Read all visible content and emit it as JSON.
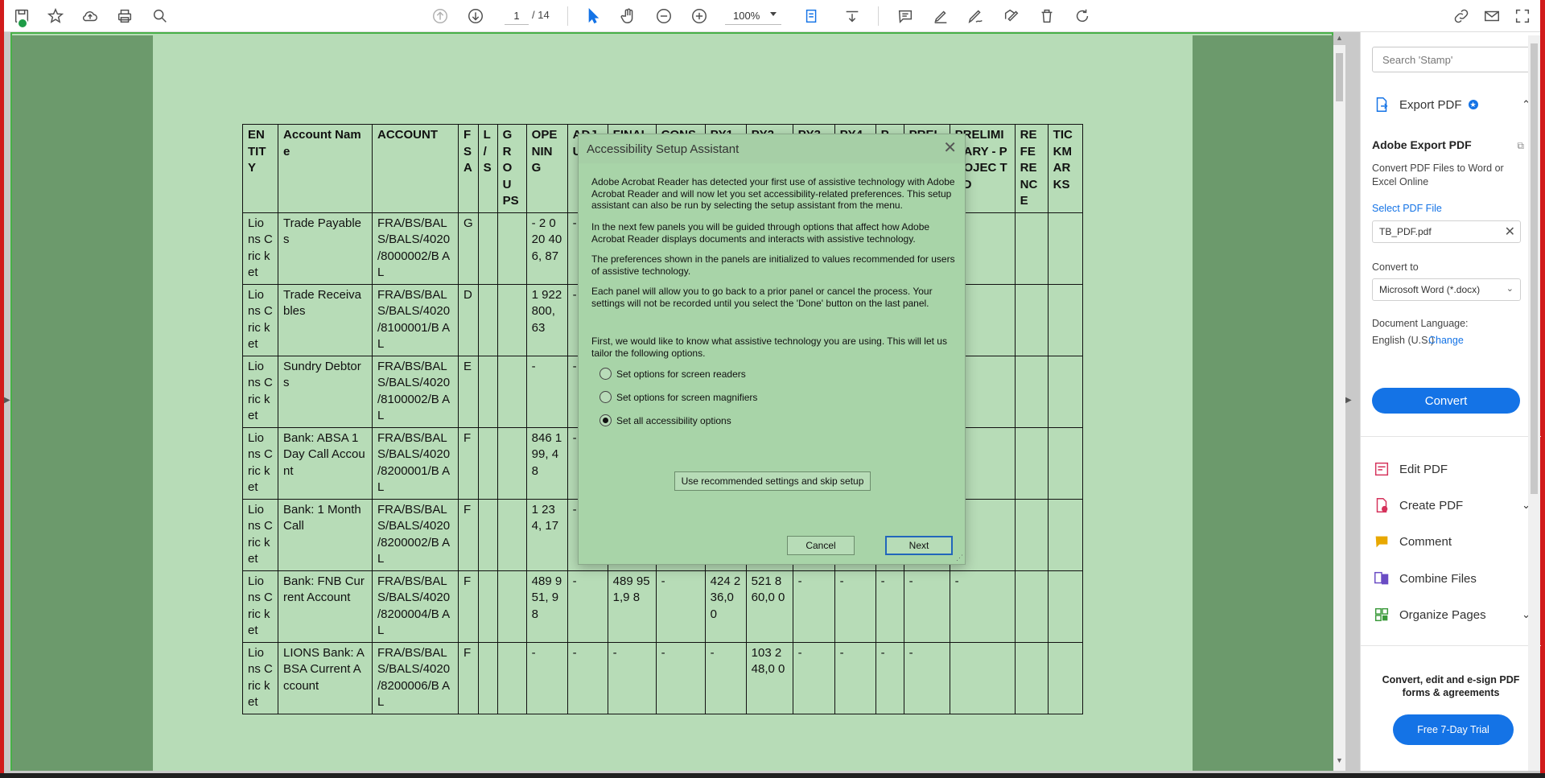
{
  "toolbar": {
    "page_current": "1",
    "page_total": "/ 14",
    "zoom": "100%"
  },
  "table": {
    "headers": [
      "EN TIT Y",
      "Account Name",
      "ACCOUNT",
      "F S A",
      "L / S",
      "G R O U PS",
      "OPE NIN G",
      "ADJ U N",
      "FINAL",
      "CONSO",
      "PY1",
      "PY2",
      "PY3",
      "PY4",
      "P",
      "PREL",
      "PRELIMI NARY - PROJEC TED",
      "RE FE RE NC E",
      "TIC KM AR KS"
    ],
    "rows": [
      [
        "Lio ns Cric ket",
        "Trade Payables",
        "FRA/BS/BAL S/BALS/4020 /8000002/B AL",
        "G",
        "",
        "",
        "- 2 020 406, 87",
        "-",
        "",
        "",
        "",
        "",
        "",
        "",
        "",
        "",
        "-",
        "",
        ""
      ],
      [
        "Lio ns Cric ket",
        "Trade Receivables",
        "FRA/BS/BAL S/BALS/4020 /8100001/B AL",
        "D",
        "",
        "",
        "1 922 800, 63",
        "-",
        "",
        "",
        "",
        "",
        "",
        "",
        "",
        "",
        "-",
        "",
        ""
      ],
      [
        "Lio ns Cric ket",
        "Sundry Debtors",
        "FRA/BS/BAL S/BALS/4020 /8100002/B AL",
        "E",
        "",
        "",
        "-",
        "-",
        "",
        "",
        "",
        "",
        "",
        "",
        "",
        "",
        "-",
        "",
        ""
      ],
      [
        "Lio ns Cric ket",
        "Bank: ABSA 1 Day Call Account",
        "FRA/BS/BAL S/BALS/4020 /8200001/B AL",
        "F",
        "",
        "",
        "846 199, 48",
        "-",
        "",
        "",
        "",
        "",
        "",
        "",
        "",
        "",
        "-",
        "",
        ""
      ],
      [
        "Lio ns Cric ket",
        "Bank: 1 Month Call",
        "FRA/BS/BAL S/BALS/4020 /8200002/B AL",
        "F",
        "",
        "",
        "1 234, 17",
        "-",
        "",
        "",
        "",
        "",
        "",
        "",
        "",
        "",
        "-",
        "",
        ""
      ],
      [
        "Lio ns Cric ket",
        "Bank: FNB Current Account",
        "FRA/BS/BAL S/BALS/4020 /8200004/B AL",
        "F",
        "",
        "",
        "489 951, 98",
        "-",
        "489 951,9 8",
        "-",
        "424 236,0 0",
        "521 860,0 0",
        "-",
        "-",
        "-",
        "-",
        "-",
        "",
        ""
      ],
      [
        "Lio ns Cric ket",
        "LIONS Bank: ABSA Current Account",
        "FRA/BS/BAL S/BALS/4020 /8200006/B AL",
        "F",
        "",
        "",
        "-",
        "-",
        "-",
        "-",
        "-",
        "103 248,0 0",
        "-",
        "-",
        "-",
        "-",
        "",
        "",
        ""
      ]
    ]
  },
  "dialog": {
    "title": "Accessibility Setup Assistant",
    "para1": "Adobe Acrobat Reader has detected your first use of assistive technology with Adobe Acrobat Reader and will now let you set accessibility-related preferences. This setup assistant can also be run by selecting the setup assistant from the  menu.",
    "para2": "In the next few panels you will be guided through options that affect how Adobe Acrobat Reader displays documents and interacts with assistive technology.",
    "para3": "The preferences shown in the panels are initialized to values recommended for users of assistive technology.",
    "para4": "Each panel will allow you to go back to a prior panel or cancel the process. Your settings will not be recorded until you select the 'Done' button on the last panel.",
    "para5": "First, we would like to know what assistive technology you are using. This will let us tailor the following options.",
    "option1": "Set options for screen readers",
    "option2": "Set options for screen magnifiers",
    "option3": "Set all accessibility options",
    "skip_button": "Use recommended settings and skip setup",
    "cancel_button": "Cancel",
    "next_button": "Next"
  },
  "right_panel": {
    "search_placeholder": "Search 'Stamp'",
    "export_pdf": "Export PDF",
    "export_title": "Adobe Export PDF",
    "export_desc": "Convert PDF Files to Word or Excel Online",
    "select_file": "Select PDF File",
    "file_name": "TB_PDF.pdf",
    "convert_to": "Convert to",
    "format": "Microsoft Word (*.docx)",
    "doc_language_label": "Document Language:",
    "doc_language": "English (U.S.)",
    "change": "Change",
    "convert_button": "Convert",
    "tools": [
      "Edit PDF",
      "Create PDF",
      "Comment",
      "Combine Files",
      "Organize Pages"
    ],
    "promo": "Convert, edit and e-sign PDF forms & agreements",
    "trial_button": "Free 7-Day Trial"
  },
  "colors": {
    "accent": "#1473e6",
    "page_background": "#b7dcb7",
    "dialog_background": "#a8d4a8"
  }
}
